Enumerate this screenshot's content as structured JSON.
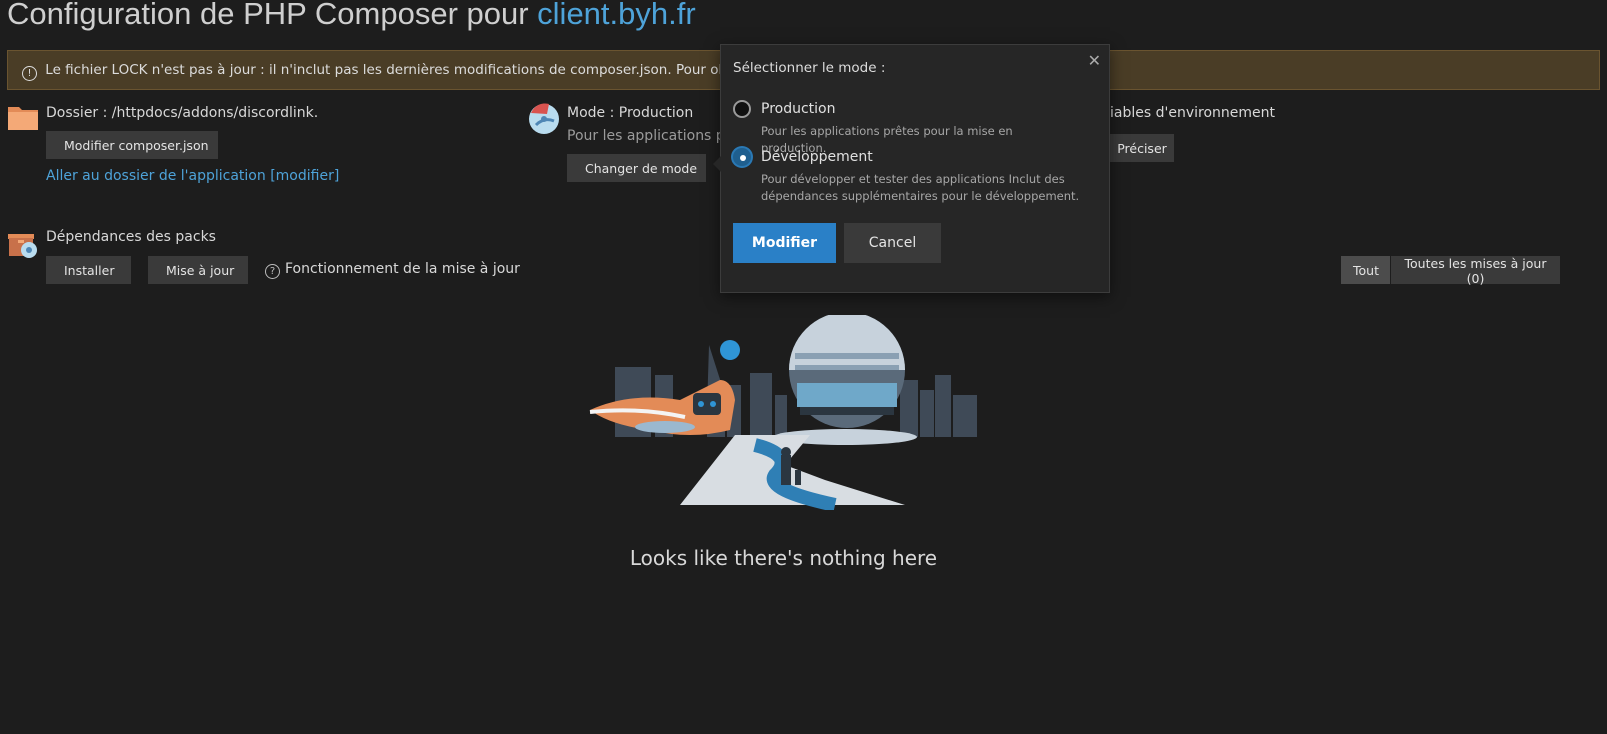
{
  "header": {
    "title_prefix": "Configuration de PHP Composer pour ",
    "domain": "client.byh.fr"
  },
  "alert": {
    "text": "Le fichier LOCK n'est pas à jour : il n'inclut pas les dernières modifications de composer.json. Pour obtenir l"
  },
  "folder": {
    "label": "Dossier : /httpdocs/addons/discordlink.",
    "edit_button": "Modifier composer.json",
    "link": "Aller au dossier de l'application [modifier]"
  },
  "mode": {
    "label": "Mode : Production",
    "description": "Pour les applications prê",
    "change_button": "Changer de mode"
  },
  "env": {
    "label": "iables d'environnement",
    "button": "Préciser"
  },
  "deps": {
    "title": "Dépendances des packs",
    "install_button": "Installer",
    "update_button": "Mise à jour",
    "help_text": "Fonctionnement de la mise à jour",
    "filter_all": "Tout",
    "filter_updates": "Toutes les mises à jour (0)"
  },
  "empty": {
    "text": "Looks like there's nothing here"
  },
  "popover": {
    "title": "Sélectionner le mode :",
    "options": [
      {
        "label": "Production",
        "description": "Pour les applications prêtes pour la mise en production.",
        "selected": false
      },
      {
        "label": "Développement",
        "description": "Pour développer et tester des applications Inclut des dépendances supplémentaires pour le développement.",
        "selected": true
      }
    ],
    "submit": "Modifier",
    "cancel": "Cancel"
  },
  "colors": {
    "background": "#1d1d1d",
    "accent": "#4ea3d9",
    "primary_button": "#2a80c7",
    "alert_bg": "#4a3d26"
  }
}
